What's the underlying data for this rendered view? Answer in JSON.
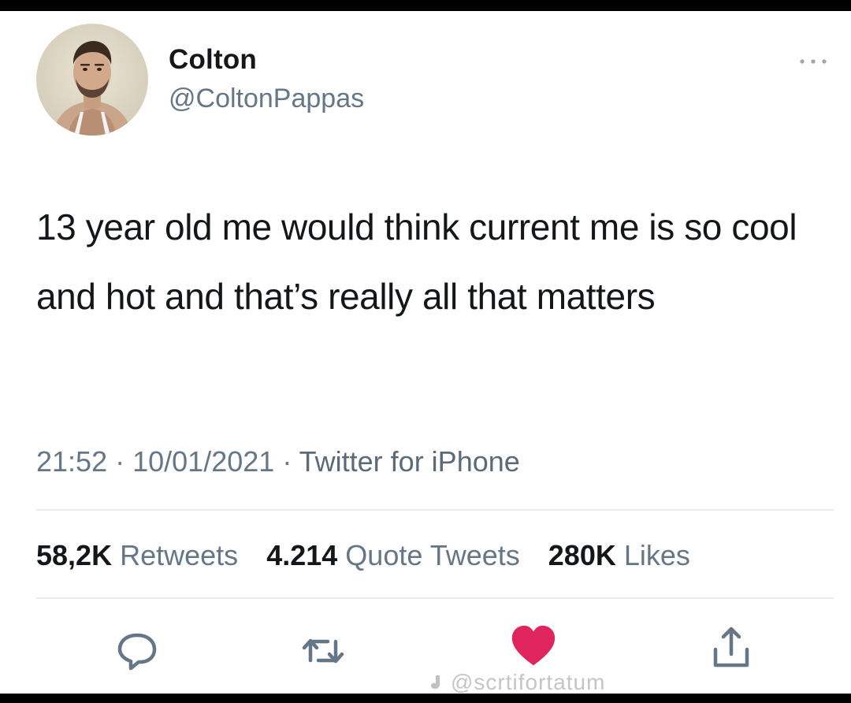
{
  "tweet": {
    "display_name": "Colton",
    "handle": "@ColtonPappas",
    "text": "13 year old me would think current me is so cool and hot and that’s really all that matters",
    "time": "21:52",
    "date": "10/01/2021",
    "source": "Twitter for iPhone",
    "stats": {
      "retweets_count": "58,2K",
      "retweets_label": "Retweets",
      "quotes_count": "4.214",
      "quotes_label": "Quote Tweets",
      "likes_count": "280K",
      "likes_label": "Likes"
    }
  },
  "actions": {
    "reply_icon": "reply-icon",
    "retweet_icon": "retweet-icon",
    "like_icon": "heart-icon",
    "share_icon": "share-icon"
  },
  "colors": {
    "primary_text": "#14171a",
    "secondary_text": "#657786",
    "divider": "#e6ecf0",
    "like_red": "#e0245e"
  },
  "watermark": "@scrtifortatum"
}
